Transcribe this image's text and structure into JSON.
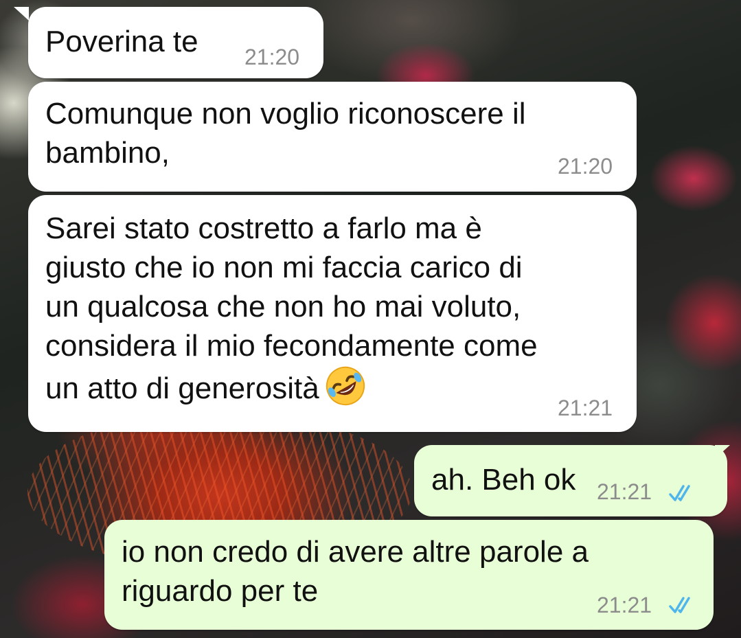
{
  "messages": [
    {
      "direction": "incoming",
      "lines": [
        "Poverina te"
      ],
      "time": "21:20"
    },
    {
      "direction": "incoming",
      "lines": [
        "Comunque non voglio riconoscere il",
        "bambino,"
      ],
      "time": "21:20"
    },
    {
      "direction": "incoming",
      "lines": [
        "Sarei stato costretto a farlo ma è",
        "giusto che io non mi faccia carico di",
        "un qualcosa che non ho mai voluto,",
        "considera il mio fecondamente come",
        "un atto di generosità"
      ],
      "emoji": "rolling-on-floor-laughing-emoji",
      "time": "21:21"
    },
    {
      "direction": "outgoing",
      "lines": [
        "ah. Beh ok"
      ],
      "time": "21:21",
      "status_icon": "double-check-read-icon"
    },
    {
      "direction": "outgoing",
      "lines": [
        "io non credo di avere altre parole a",
        "riguardo per te"
      ],
      "time": "21:21",
      "status_icon": "double-check-read-icon"
    }
  ],
  "colors": {
    "incoming_bubble": "#ffffff",
    "outgoing_bubble": "#e7fed6",
    "timestamp": "#8c8c8c",
    "read_ticks": "#4fb6ec"
  }
}
